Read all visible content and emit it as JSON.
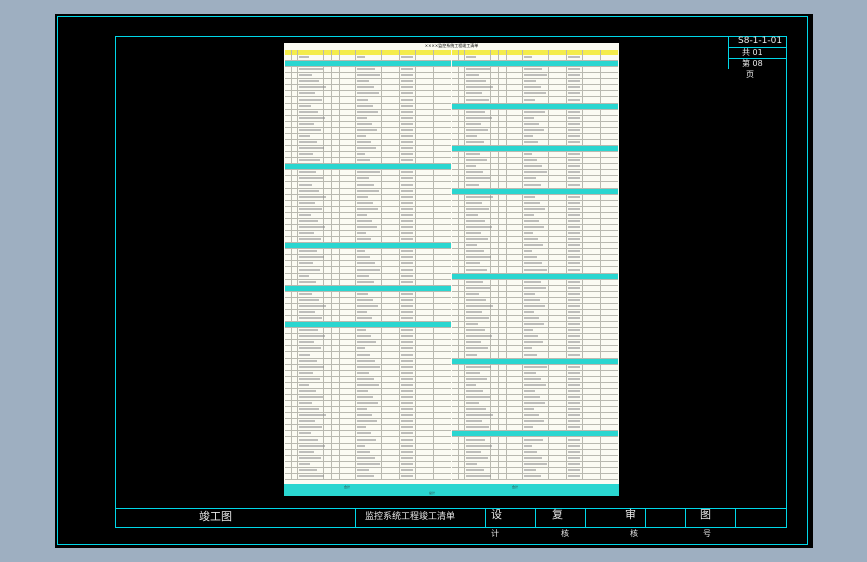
{
  "colors": {
    "background": "#9eafc1",
    "canvas": "#000000",
    "frame_line": "#00d7e8",
    "sheet": "#fbfbf3",
    "header_yellow": "#f4ec4a",
    "category_cyan": "#2ad6d0"
  },
  "corner_block": {
    "drawing_code": "S8-1-1-01",
    "line2": "共 01",
    "line3": "第 08",
    "line4": "页"
  },
  "title_bar": {
    "drawing_name": "竣工图",
    "project_label": "监控系统工程竣工清单",
    "design": "设",
    "design_sub": "计",
    "review": "复",
    "review_sub": "核",
    "audit": "审",
    "audit_sub": "核",
    "drawing_no": "图",
    "drawing_no_sub": "号"
  },
  "sheet": {
    "title": "××××监控系统工程竣工清单",
    "left_category_rows": [
      1,
      18,
      31,
      38,
      44
    ],
    "right_category_rows": [
      1,
      8,
      15,
      22,
      36,
      50,
      62
    ],
    "left_row_count": 70,
    "right_row_count": 70,
    "footer_total_label": "合计",
    "footer_total_value": "",
    "footer_sum_label": "总计",
    "footer_sum_value": ""
  }
}
